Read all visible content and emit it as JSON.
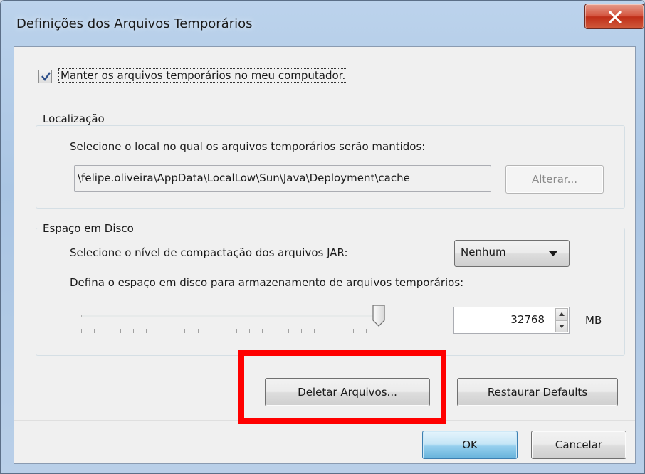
{
  "window": {
    "title": "Definições dos Arquivos Temporários",
    "close_glyph": "x"
  },
  "keep_files": {
    "checked": true,
    "label": "Manter os arquivos temporários no meu computador."
  },
  "location": {
    "group_title": "Localização",
    "instruction": "Selecione o local no qual os arquivos temporários serão mantidos:",
    "path": "\\felipe.oliveira\\AppData\\LocalLow\\Sun\\Java\\Deployment\\cache",
    "change_button": "Alterar..."
  },
  "disk_space": {
    "group_title": "Espaço em Disco",
    "compression_label": "Selecione o nível de compactação dos arquivos JAR:",
    "compression_value": "Nenhum",
    "space_label": "Defina o espaço em disco para armazenamento de arquivos temporários:",
    "space_value": "32768",
    "unit": "MB",
    "slider_level": 1.0
  },
  "actions": {
    "delete_button": "Deletar Arquivos...",
    "restore_button": "Restaurar Defaults"
  },
  "footer": {
    "ok_button": "OK",
    "cancel_button": "Cancelar"
  },
  "colors": {
    "highlight": "#ff0000",
    "close_button": "#c9361d",
    "default_button": "#98d1ef"
  }
}
